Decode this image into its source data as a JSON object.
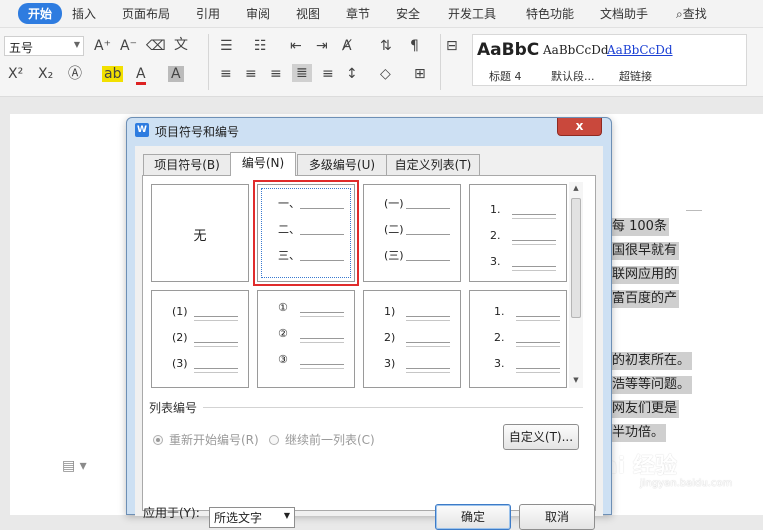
{
  "menu": {
    "items": [
      "开始",
      "插入",
      "页面布局",
      "引用",
      "审阅",
      "视图",
      "章节",
      "安全",
      "开发工具",
      "特色功能",
      "文档助手"
    ],
    "search_label": "查找"
  },
  "ribbon": {
    "font_size": "五号",
    "styles": [
      {
        "preview": "AaBbC",
        "name": "标题 4"
      },
      {
        "preview": "AaBbCcDd",
        "name": "默认段..."
      },
      {
        "preview": "AaBbCcDd",
        "name": "超链接"
      }
    ]
  },
  "document": {
    "lines": [
      "每 100条",
      "国很早就有",
      "联网应用的",
      "富百度的产",
      "的初衷所在。",
      "浩等等问题。",
      "网友们更是",
      "半功倍。"
    ],
    "watermark": "Bai 经验",
    "watermark_sub": "jingyan.baidu.com"
  },
  "dialog": {
    "title": "项目符号和编号",
    "close_label": "x",
    "tabs": [
      "项目符号(B)",
      "编号(N)",
      "多级编号(U)",
      "自定义列表(T)"
    ],
    "active_tab": 1,
    "none_label": "无",
    "styles": [
      [
        "一、",
        "二、",
        "三、"
      ],
      [
        "(一)",
        "(二)",
        "(三)"
      ],
      [
        "1.",
        "2.",
        "3."
      ],
      [
        "(1)",
        "(2)",
        "(3)"
      ],
      [
        "①",
        "②",
        "③"
      ],
      [
        "1)",
        "2)",
        "3)"
      ],
      [
        "1.",
        "2.",
        "3."
      ]
    ],
    "list_group_title": "列表编号",
    "radio_restart": "重新开始编号(R)",
    "radio_continue": "继续前一列表(C)",
    "customize_label": "自定义(T)...",
    "applies_to_label": "应用于(Y):",
    "applies_to_value": "所选文字",
    "ok_label": "确定",
    "cancel_label": "取消"
  }
}
